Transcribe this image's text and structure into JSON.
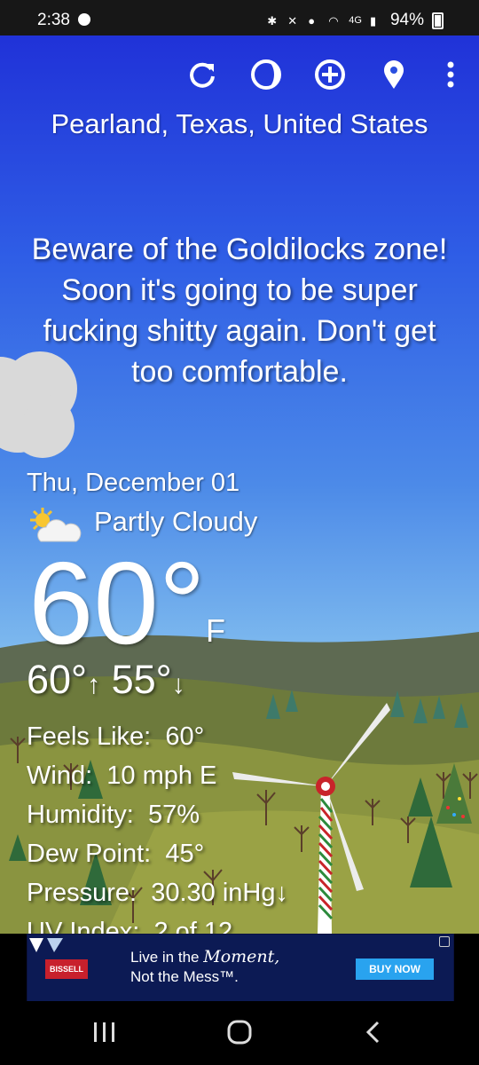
{
  "status_bar": {
    "time": "2:38",
    "network": "4G",
    "battery": "94%"
  },
  "toolbar": {
    "icons": [
      "refresh-icon",
      "moon-icon",
      "add-location-icon",
      "location-pin-icon",
      "more-vert-icon"
    ]
  },
  "weather": {
    "location": "Pearland, Texas, United States",
    "message": "Beware of the Goldilocks zone! Soon it's going to be super fucking shitty again. Don't get too comfortable.",
    "date": "Thu, December 01",
    "condition": "Partly Cloudy",
    "temperature": "60°",
    "unit": "F",
    "high": "60°",
    "low": "55°",
    "details": [
      {
        "label": "Feels Like:",
        "value": "60°"
      },
      {
        "label": "Wind:",
        "value": "10 mph E"
      },
      {
        "label": "Humidity:",
        "value": "57%"
      },
      {
        "label": "Dew Point:",
        "value": "45°"
      },
      {
        "label": "Pressure:",
        "value": "30.30 inHg↓"
      },
      {
        "label": "UV Index:",
        "value": "2 of 12"
      }
    ]
  },
  "ad": {
    "brand": "BISSELL",
    "line1_prefix": "Live in the ",
    "line1_script": "Moment,",
    "line2": "Not the Mess™.",
    "cta": "BUY NOW"
  },
  "colors": {
    "sky_top": "#2032d8",
    "sky_bottom": "#a9d6f1",
    "hill": "#7f8a35",
    "ad_bg": "#0c1a54",
    "cta": "#29a3ef"
  }
}
